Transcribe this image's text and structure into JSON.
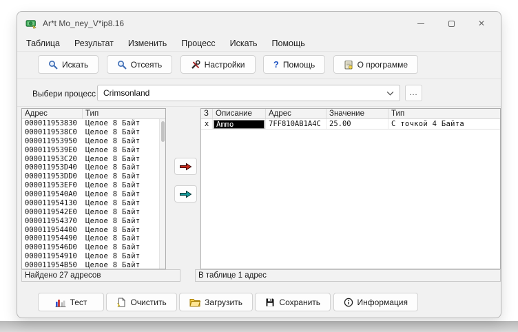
{
  "window": {
    "title": "Ar*t Mo_ney_V*ip8.16",
    "controls": {
      "close": "✕"
    }
  },
  "menu": {
    "items": [
      "Таблица",
      "Результат",
      "Изменить",
      "Процесс",
      "Искать",
      "Помощь"
    ]
  },
  "toolbar": {
    "search": "Искать",
    "filter": "Отсеять",
    "settings": "Настройки",
    "help": "Помощь",
    "about": "О программе",
    "help_glyph": "?"
  },
  "process": {
    "label": "Выбери процесс",
    "selected": "Crimsonland",
    "browse": "..."
  },
  "left_panel": {
    "columns": {
      "address": "Адрес",
      "type": "Тип"
    },
    "rows": [
      {
        "address": "000011953830",
        "type": "Целое 8 Байт"
      },
      {
        "address": "0000119538C0",
        "type": "Целое 8 Байт"
      },
      {
        "address": "000011953950",
        "type": "Целое 8 Байт"
      },
      {
        "address": "0000119539E0",
        "type": "Целое 8 Байт"
      },
      {
        "address": "000011953C20",
        "type": "Целое 8 Байт"
      },
      {
        "address": "000011953D40",
        "type": "Целое 8 Байт"
      },
      {
        "address": "000011953DD0",
        "type": "Целое 8 Байт"
      },
      {
        "address": "000011953EF0",
        "type": "Целое 8 Байт"
      },
      {
        "address": "0000119540A0",
        "type": "Целое 8 Байт"
      },
      {
        "address": "000011954130",
        "type": "Целое 8 Байт"
      },
      {
        "address": "0000119542E0",
        "type": "Целое 8 Байт"
      },
      {
        "address": "000011954370",
        "type": "Целое 8 Байт"
      },
      {
        "address": "000011954400",
        "type": "Целое 8 Байт"
      },
      {
        "address": "000011954490",
        "type": "Целое 8 Байт"
      },
      {
        "address": "0000119546D0",
        "type": "Целое 8 Байт"
      },
      {
        "address": "000011954910",
        "type": "Целое 8 Байт"
      },
      {
        "address": "000011954B50",
        "type": "Целое 8 Байт"
      }
    ],
    "status": "Найдено 27 адресов"
  },
  "right_panel": {
    "columns": {
      "freeze": "З",
      "description": "Описание",
      "address": "Адрес",
      "value": "Значение",
      "type": "Тип"
    },
    "rows": [
      {
        "freeze": "x",
        "description": "Ammo",
        "address": "7FF810AB1A4C",
        "value": "25.00",
        "type": "С точкой 4 Байта"
      }
    ],
    "status": "В таблице 1 адрес"
  },
  "bottom_toolbar": {
    "test": "Тест",
    "clear": "Очистить",
    "load": "Загрузить",
    "save": "Сохранить",
    "info": "Информация"
  },
  "colors": {
    "arrow_red": "#c52a1a",
    "arrow_teal": "#159a9a",
    "selection_bg": "#000000",
    "selection_text": "#ffffff"
  }
}
